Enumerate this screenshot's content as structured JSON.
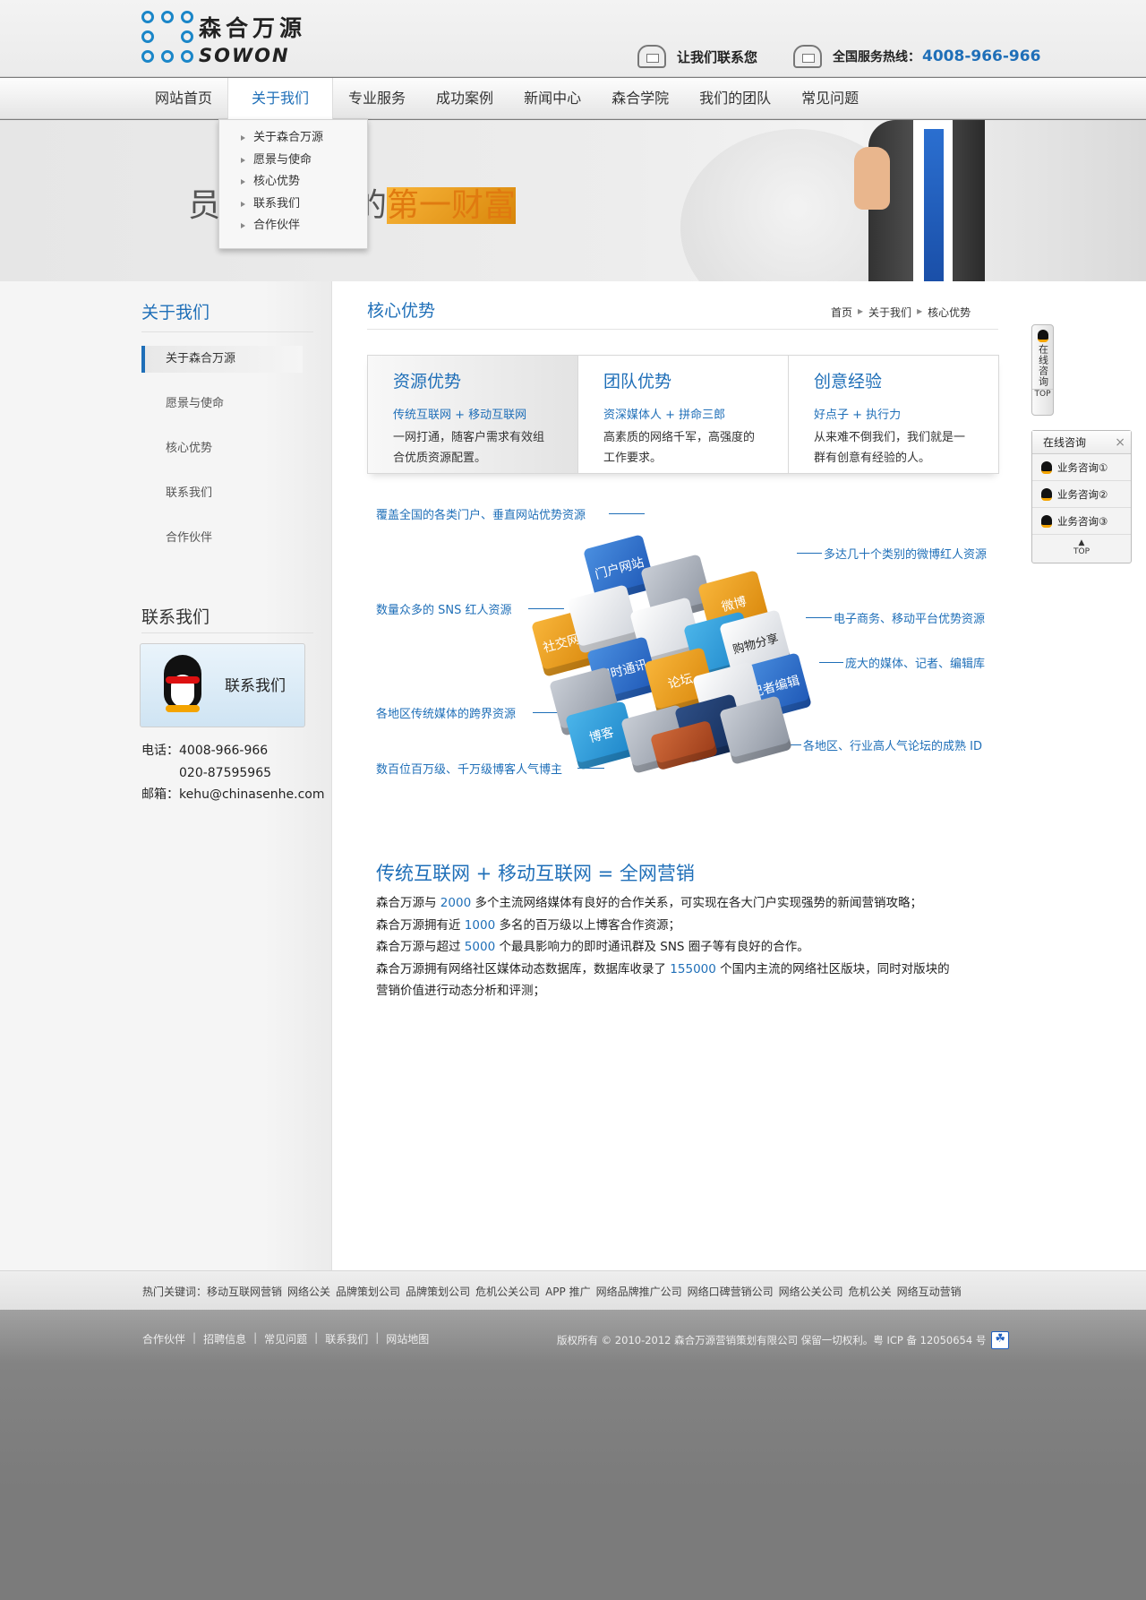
{
  "header": {
    "logo_cn": "森合万源",
    "logo_en": "SOWON",
    "contact_link": "让我们联系您",
    "hotline_label": "全国服务热线：",
    "hotline_number": "4008-966-966"
  },
  "nav": {
    "items": [
      "网站首页",
      "关于我们",
      "专业服务",
      "成功案例",
      "新闻中心",
      "森合学院",
      "我们的团队",
      "常见问题"
    ],
    "active_index": 1
  },
  "dropdown": {
    "items": [
      "关于森合万源",
      "愿景与使命",
      "核心优势",
      "联系我们",
      "合作伙伴"
    ]
  },
  "banner": {
    "slogan_part1": "员",
    "slogan_part2": "的",
    "slogan_highlight": "第一财富"
  },
  "sidebar": {
    "title": "关于我们",
    "items": [
      "关于森合万源",
      "愿景与使命",
      "核心优势",
      "联系我们",
      "合作伙伴"
    ],
    "active_index": 0,
    "contact_title": "联系我们",
    "qq_label": "联系我们",
    "phone_line1": "电话：4008-966-966",
    "phone_line2": "020-87595965",
    "email_line": "邮箱：kehu@chinasenhe.com"
  },
  "main": {
    "title": "核心优势",
    "breadcrumb": [
      "首页",
      "关于我们",
      "核心优势"
    ],
    "advantages": [
      {
        "title": "资源优势",
        "sub": "传统互联网 + 移动互联网",
        "desc": "一网打通，随客户需求有效组合优质资源配置。"
      },
      {
        "title": "团队优势",
        "sub": "资深媒体人 + 拼命三郎",
        "desc": "高素质的网络千军，高强度的工作要求。"
      },
      {
        "title": "创意经验",
        "sub": "好点子 + 执行力",
        "desc": "从来难不倒我们，我们就是一群有创意有经验的人。"
      }
    ],
    "cube_labels": {
      "l1": "覆盖全国的各类门户、垂直网站优势资源",
      "l2": "数量众多的 SNS 红人资源",
      "l3": "各地区传统媒体的跨界资源",
      "l4": "数百位百万级、千万级博客人气博主",
      "r1": "多达几十个类别的微博红人资源",
      "r2": "电子商务、移动平台优势资源",
      "r3": "庞大的媒体、记者、编辑库",
      "r4": "各地区、行业高人气论坛的成熟 ID"
    },
    "cube_tiles": {
      "portal": "门户网站",
      "weibo": "微博",
      "social": "社交网站",
      "im": "即时通讯",
      "forum": "论坛",
      "shopping": "购物分享",
      "reporter": "记者编辑",
      "blog": "博客"
    },
    "promo_title": "传统互联网 + 移动互联网 = 全网营销",
    "promo": {
      "p1a": "森合万源与",
      "p1n": "2000",
      "p1b": "多个主流网络媒体有良好的合作关系，可实现在各大门户实现强势的新闻营销攻略；",
      "p2a": "森合万源拥有近",
      "p2n": "1000",
      "p2b": "多名的百万级以上博客合作资源；",
      "p3a": "森合万源与超过",
      "p3n": "5000",
      "p3b": "个最具影响力的即时通讯群及 SNS 圈子等有良好的合作。",
      "p4a": "森合万源拥有网络社区媒体动态数据库，数据库收录了",
      "p4n": "155000",
      "p4b": "个国内主流的网络社区版块，同时对版块的营销价值进行动态分析和评测；"
    }
  },
  "float": {
    "consult_vertical": "在线咨询",
    "top": "TOP",
    "panel_title": "在线咨询",
    "close": "×",
    "items": [
      "业务咨询①",
      "业务咨询②",
      "业务咨询③"
    ]
  },
  "keywords": {
    "label": "热门关键词：",
    "items": [
      "移动互联网营销",
      "网络公关",
      "品牌策划公司",
      "品牌策划公司",
      "危机公关公司",
      "APP 推广",
      "网络品牌推广公司",
      "网络口碑营销公司",
      "网络公关公司",
      "危机公关",
      "网络互动营销"
    ]
  },
  "footer": {
    "links": [
      "合作伙伴",
      "招聘信息",
      "常见问题",
      "联系我们",
      "网站地图"
    ],
    "copyright": "版权所有 © 2010-2012 森合万源营销策划有限公司 保留一切权利。粤 ICP 备 12050654 号"
  },
  "colors": {
    "accent": "#1f6fb8",
    "highlight": "#e07a10",
    "footer_bg": "#7b7b7b"
  }
}
